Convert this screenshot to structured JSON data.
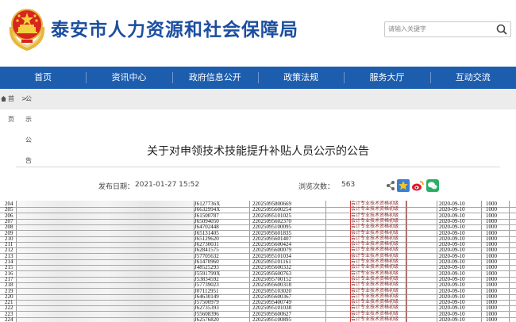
{
  "header": {
    "site_title": "泰安市人力资源和社会保障局",
    "search_placeholder": "请输入关键字"
  },
  "nav": {
    "items": [
      {
        "label": "首页"
      },
      {
        "label": "资讯中心"
      },
      {
        "label": "政府信息公开"
      },
      {
        "label": "政策法规"
      },
      {
        "label": "服务大厅"
      },
      {
        "label": "互动交流"
      }
    ],
    "color": "#1d5dae"
  },
  "breadcrumb": {
    "home": "首页",
    "current": "公示公告"
  },
  "article": {
    "title": "关于对申领技术技能提升补贴人员公示的公告",
    "publish_label": "发布日期：",
    "publish_date": "2021-01-27 15:52",
    "views_label": "浏览次数：",
    "views": "563"
  },
  "table": {
    "rows": [
      {
        "no": "204",
        "id": "J6127736X",
        "cert": "22025095800669",
        "type": "会计专业技术资格初级",
        "date": "2020-09-10",
        "amount": "1000"
      },
      {
        "no": "205",
        "id": "J6632994X",
        "cert": "22025095600254",
        "type": "会计专业技术资格初级",
        "date": "2020-09-10",
        "amount": "1000"
      },
      {
        "no": "206",
        "id": "J61500787",
        "cert": "22025095101025",
        "type": "会计专业技术资格初级",
        "date": "2020-09-10",
        "amount": "1000"
      },
      {
        "no": "207",
        "id": "J65094050",
        "cert": "22025095602370",
        "type": "会计专业技术资格初级",
        "date": "2020-09-10",
        "amount": "1000"
      },
      {
        "no": "208",
        "id": "J64702448",
        "cert": "22025095100095",
        "type": "会计专业技术资格初级",
        "date": "2020-09-10",
        "amount": "1000"
      },
      {
        "no": "209",
        "id": "J65131405",
        "cert": "22025095601835",
        "type": "会计专业技术资格初级",
        "date": "2020-09-10",
        "amount": "1000"
      },
      {
        "no": "210",
        "id": "J65129620",
        "cert": "22025095601407",
        "type": "会计专业技术资格初级",
        "date": "2020-09-10",
        "amount": "1000"
      },
      {
        "no": "211",
        "id": "J62730031",
        "cert": "22025095600424",
        "type": "会计专业技术资格初级",
        "date": "2020-09-10",
        "amount": "1000"
      },
      {
        "no": "212",
        "id": "J62841575",
        "cert": "22025095600079",
        "type": "会计专业技术资格初级",
        "date": "2020-09-10",
        "amount": "1000"
      },
      {
        "no": "213",
        "id": "J57705632",
        "cert": "22025095101034",
        "type": "会计专业技术资格初级",
        "date": "2020-09-10",
        "amount": "1000"
      },
      {
        "no": "214",
        "id": "J61470960",
        "cert": "22025095101161",
        "type": "会计专业技术资格初级",
        "date": "2020-09-10",
        "amount": "1000"
      },
      {
        "no": "215",
        "id": "J48525293",
        "cert": "22025095600332",
        "type": "会计专业技术资格初级",
        "date": "2020-09-10",
        "amount": "1000"
      },
      {
        "no": "216",
        "id": "J5591799X",
        "cert": "22025095600763",
        "type": "会计专业技术资格初级",
        "date": "2020-09-10",
        "amount": "1000"
      },
      {
        "no": "217",
        "id": "J53834592",
        "cert": "22025095700152",
        "type": "会计专业技术资格初级",
        "date": "2020-09-10",
        "amount": "1000"
      },
      {
        "no": "218",
        "id": "J57739023",
        "cert": "22025095600318",
        "type": "会计专业技术资格初级",
        "date": "2020-09-10",
        "amount": "1000"
      },
      {
        "no": "219",
        "id": "J07112951",
        "cert": "22025095103020",
        "type": "会计专业技术资格初级",
        "date": "2020-09-10",
        "amount": "1000"
      },
      {
        "no": "220",
        "id": "J64630149",
        "cert": "22025095600367",
        "type": "会计专业技术资格初级",
        "date": "2020-09-10",
        "amount": "1000"
      },
      {
        "no": "221",
        "id": "J57500979",
        "cert": "22025095400749",
        "type": "会计专业技术资格初级",
        "date": "2020-09-10",
        "amount": "1000"
      },
      {
        "no": "222",
        "id": "J62735393",
        "cert": "22025095101038",
        "type": "会计专业技术资格初级",
        "date": "2020-09-10",
        "amount": "1000"
      },
      {
        "no": "223",
        "id": "J55608396",
        "cert": "22025095600627",
        "type": "会计专业技术资格初级",
        "date": "2020-09-10",
        "amount": "1000"
      },
      {
        "no": "224",
        "id": "J62576820",
        "cert": "22025095100895",
        "type": "会计专业技术资格初级",
        "date": "2020-09-10",
        "amount": "1000"
      }
    ]
  },
  "icons": {
    "emblem": "national-emblem-icon",
    "search": "search-icon",
    "home": "home-icon",
    "share": "share-icon",
    "favorite": "star-icon",
    "weibo": "weibo-icon",
    "wechat": "wechat-icon"
  },
  "colors": {
    "title_blue": "#1c4ea0",
    "highlight_red": "#d23b3b"
  }
}
